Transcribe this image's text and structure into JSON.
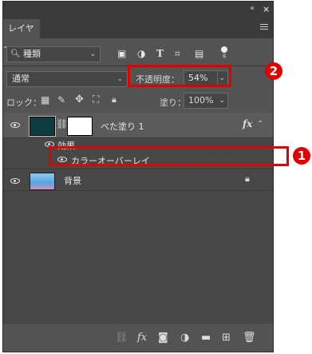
{
  "panel": {
    "title_tab": "レイヤー",
    "collapse_glyph": "«",
    "close_glyph": "×"
  },
  "filter": {
    "kind_icon": "search-icon",
    "kind_label": "種類"
  },
  "blend": {
    "mode": "通常",
    "opacity_label": "不透明度：",
    "opacity_value": "54%"
  },
  "lock": {
    "label": "ロック：",
    "fill_label": "塗り：",
    "fill_value": "100%"
  },
  "layers": [
    {
      "name": "べた塗り 1",
      "fx": "fx",
      "type": "solid-fill",
      "swatch_color": "#0e3b3e"
    },
    {
      "name": "効果"
    },
    {
      "name": "カラーオーバーレイ"
    },
    {
      "name": "背景",
      "type": "background"
    }
  ],
  "annotations": {
    "badge1": "1",
    "badge2": "2",
    "highlight_color": "#e00000"
  },
  "bottom": {
    "fx_label": "fx"
  }
}
